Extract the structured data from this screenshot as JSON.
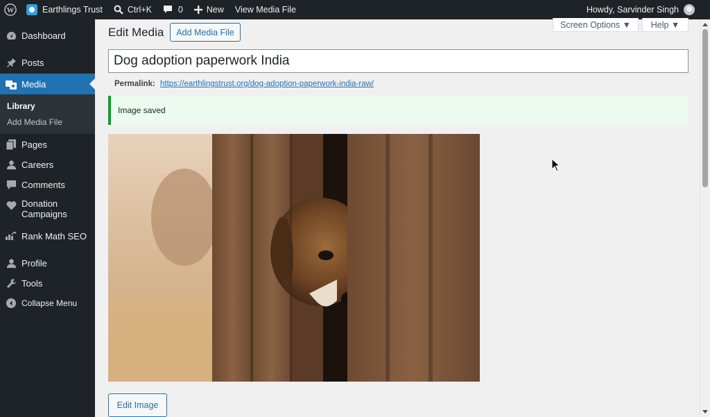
{
  "adminbar": {
    "site_name": "Earthlings Trust",
    "search_shortcut": "Ctrl+K",
    "comments_count": "0",
    "new_label": "New",
    "view_label": "View Media File",
    "howdy": "Howdy, Sarvinder Singh"
  },
  "sidebar": {
    "dashboard": "Dashboard",
    "posts": "Posts",
    "media": "Media",
    "library": "Library",
    "add_media_file": "Add Media File",
    "pages": "Pages",
    "careers": "Careers",
    "comments": "Comments",
    "donation_line1": "Donation",
    "donation_line2": "Campaigns",
    "rankmath": "Rank Math SEO",
    "profile": "Profile",
    "tools": "Tools",
    "collapse": "Collapse Menu"
  },
  "header": {
    "screen_options": "Screen Options ▼",
    "help": "Help ▼",
    "title": "Edit Media",
    "add_button": "Add Media File"
  },
  "form": {
    "title_value": "Dog adoption paperwork India",
    "permalink_label": "Permalink:",
    "permalink_url": "https://earthlingstrust.org/dog-adoption-paperwork-india-raw/",
    "notice": "Image saved",
    "edit_image": "Edit Image"
  },
  "colors": {
    "admin_dark": "#1d2327",
    "accent": "#2271b1",
    "success": "#00a32a",
    "background": "#f0f0f1"
  }
}
